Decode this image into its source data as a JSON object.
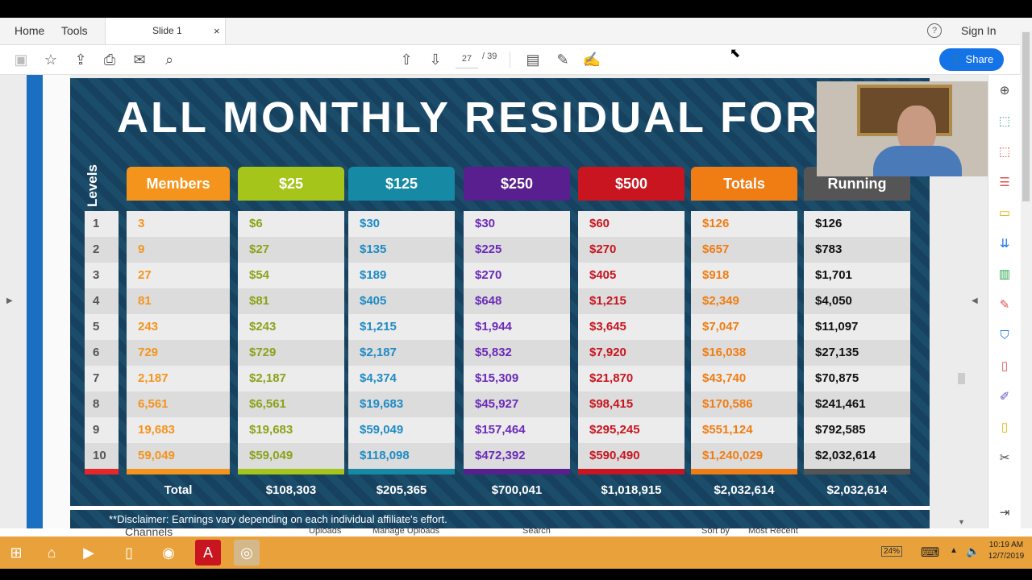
{
  "tabs": [
    {
      "label": "Home"
    },
    {
      "label": "Tools"
    },
    {
      "label": "Slide 1"
    }
  ],
  "tab_close": "×",
  "header": {
    "help": "?",
    "signin": "Sign In"
  },
  "toolbar": {
    "page_current": "27",
    "page_sep": "/ 39",
    "share": "Share"
  },
  "slide": {
    "title": "ALL MONTHLY RESIDUAL FOR L",
    "levels_label": "Levels",
    "columns": [
      {
        "head": "Members",
        "color": "#f5941d",
        "text_color": "#f5941d",
        "values": [
          "3",
          "9",
          "27",
          "81",
          "243",
          "729",
          "2,187",
          "6,561",
          "19,683",
          "59,049"
        ],
        "total": "Total"
      },
      {
        "head": "$25",
        "color": "#a6c51b",
        "text_color": "#8aa31a",
        "values": [
          "$6",
          "$27",
          "$54",
          "$81",
          "$243",
          "$729",
          "$2,187",
          "$6,561",
          "$19,683",
          "$59,049"
        ],
        "total": "$108,303"
      },
      {
        "head": "$125",
        "color": "#168aa5",
        "text_color": "#1f8bc4",
        "values": [
          "$30",
          "$135",
          "$189",
          "$405",
          "$1,215",
          "$2,187",
          "$4,374",
          "$19,683",
          "$59,049",
          "$118,098"
        ],
        "total": "$205,365"
      },
      {
        "head": "$250",
        "color": "#5a1f8f",
        "text_color": "#6b2ab8",
        "values": [
          "$30",
          "$225",
          "$270",
          "$648",
          "$1,944",
          "$5,832",
          "$15,309",
          "$45,927",
          "$157,464",
          "$472,392"
        ],
        "total": "$700,041"
      },
      {
        "head": "$500",
        "color": "#c8151f",
        "text_color": "#c8151f",
        "values": [
          "$60",
          "$270",
          "$405",
          "$1,215",
          "$3,645",
          "$7,920",
          "$21,870",
          "$98,415",
          "$295,245",
          "$590,490"
        ],
        "total": "$1,018,915"
      },
      {
        "head": "Totals",
        "color": "#f07d14",
        "text_color": "#f07d14",
        "values": [
          "$126",
          "$657",
          "$918",
          "$2,349",
          "$7,047",
          "$16,038",
          "$43,740",
          "$170,586",
          "$551,124",
          "$1,240,029"
        ],
        "total": "$2,032,614"
      },
      {
        "head": "Running",
        "color": "#555555",
        "text_color": "#111111",
        "values": [
          "$126",
          "$783",
          "$1,701",
          "$4,050",
          "$11,097",
          "$27,135",
          "$70,875",
          "$241,461",
          "$792,585",
          "$2,032,614"
        ],
        "total": "$2,032,614"
      }
    ],
    "levels": [
      "1",
      "2",
      "3",
      "4",
      "5",
      "6",
      "7",
      "8",
      "9",
      "10"
    ],
    "disclaimer": "**Disclaimer: Earnings vary depending on each individual affiliate's effort."
  },
  "behind_window": {
    "t1": "Channels",
    "t2": "Uploads",
    "t3": "Manage Uploads",
    "t4": "Search",
    "t5": "Sort by",
    "t6": "Most Recent"
  },
  "taskbar": {
    "battery": "24%",
    "time": "10:19 AM",
    "date": "12/7/2019"
  }
}
